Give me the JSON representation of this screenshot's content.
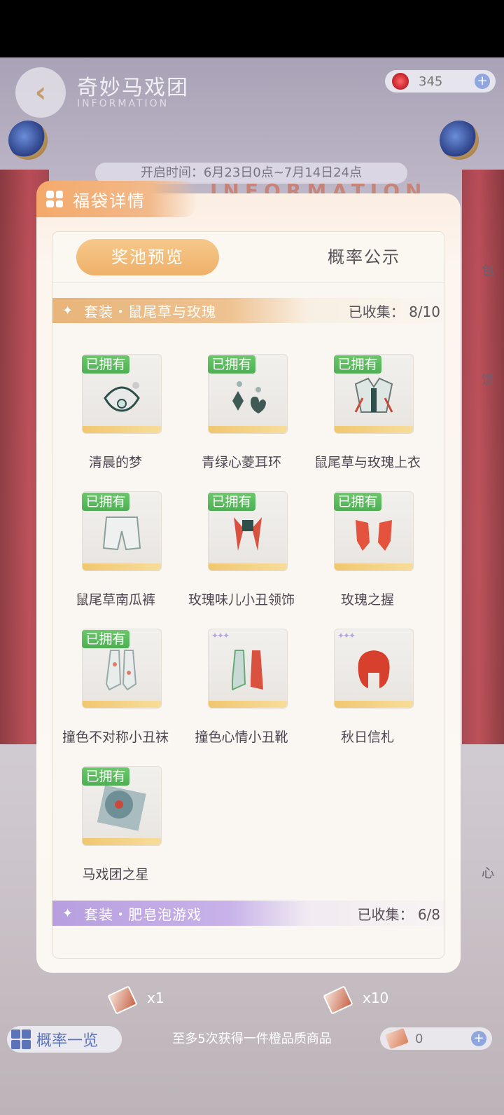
{
  "header": {
    "title": "奇妙马戏团",
    "subtitle": "INFORMATION",
    "currency_value": "345",
    "open_time": "开启时间：6月23日0点~7月14日24点",
    "watermark": "INFORMATION",
    "side_labels": [
      "包",
      "馈",
      "心"
    ]
  },
  "dialog": {
    "title": "福袋详情",
    "tabs": [
      {
        "label": "奖池预览",
        "active": true
      },
      {
        "label": "概率公示",
        "active": false
      }
    ],
    "sets": [
      {
        "name": "套装・鼠尾草与玫瑰",
        "collected_label": "已收集：",
        "collected": "8/10",
        "items": [
          {
            "name": "清晨的梦",
            "owned": true
          },
          {
            "name": "青绿心菱耳环",
            "owned": true
          },
          {
            "name": "鼠尾草与玫瑰上衣",
            "owned": true
          },
          {
            "name": "鼠尾草南瓜裤",
            "owned": true
          },
          {
            "name": "玫瑰味儿小丑领饰",
            "owned": true
          },
          {
            "name": "玫瑰之握",
            "owned": true
          },
          {
            "name": "撞色不对称小丑袜",
            "owned": true
          },
          {
            "name": "撞色心情小丑靴",
            "owned": false
          },
          {
            "name": "秋日信札",
            "owned": false
          },
          {
            "name": "马戏团之星",
            "owned": true
          }
        ]
      },
      {
        "name": "套装・肥皂泡游戏",
        "collected_label": "已收集：",
        "collected": "6/8"
      }
    ],
    "owned_badge": "已拥有",
    "card_stars": "✦✦✦"
  },
  "footer": {
    "draw_one": "x1",
    "draw_ten": "x10",
    "prob_button": "概率一览",
    "notice": "至多5次获得一件橙品质商品",
    "ticket_count": "0",
    "plus": "+"
  },
  "colors": {
    "accent_orange": "#eeb06a",
    "owned_green": "#4fae55",
    "set2_purple": "#b79fdf"
  }
}
